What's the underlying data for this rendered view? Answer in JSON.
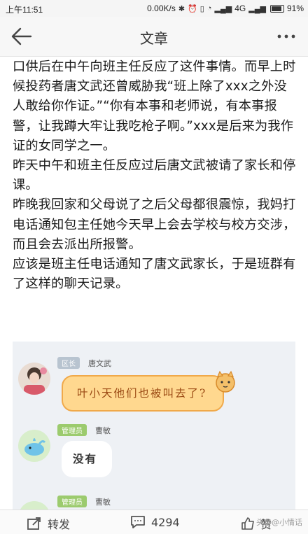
{
  "status_bar": {
    "time": "上午11:51",
    "network_speed": "0.00K/s",
    "network_type": "4G",
    "battery": "91%"
  },
  "nav": {
    "title": "文章",
    "back_icon": "arrow-left-icon",
    "more_icon": "more-dots-icon"
  },
  "article": {
    "paragraphs": [
      "口供后在中午向班主任反应了这件事情。而早上时候投药者唐文武还曾威胁我“班上除了xxx之外没人敢给你作证。”“你有本事和老师说，有本事报警，让我蹲大牢让我吃枪子啊。”xxx是后来为我作证的女同学之一。",
      "昨天中午和班主任反应过后唐文武被请了家长和停课。",
      "昨晚我回家和父母说了之后父母都很震惊，我妈打电话通知包主任她今天早上会去学校与校方交涉，而且会去派出所报警。",
      "应该是班主任电话通知了唐文武家长，于是班群有了这样的聊天记录。"
    ]
  },
  "chat": {
    "messages": [
      {
        "tag": "区长",
        "name": "唐文武",
        "text": "叶小天他们也被叫去了?"
      },
      {
        "tag": "管理员",
        "name": "曹敏",
        "text": "没有"
      },
      {
        "tag": "管理员",
        "name": "曹敏",
        "text": ""
      }
    ],
    "colors": {
      "tag_a": "#b8c4d0",
      "tag_b": "#9ccb6e",
      "bubble_orange": "#ffd88f",
      "bubble_white": "#ffffff"
    }
  },
  "bottom_bar": {
    "repost_label": "转发",
    "comment_count": "4294",
    "like_label": "赞",
    "watermark": "头条@小情话"
  }
}
